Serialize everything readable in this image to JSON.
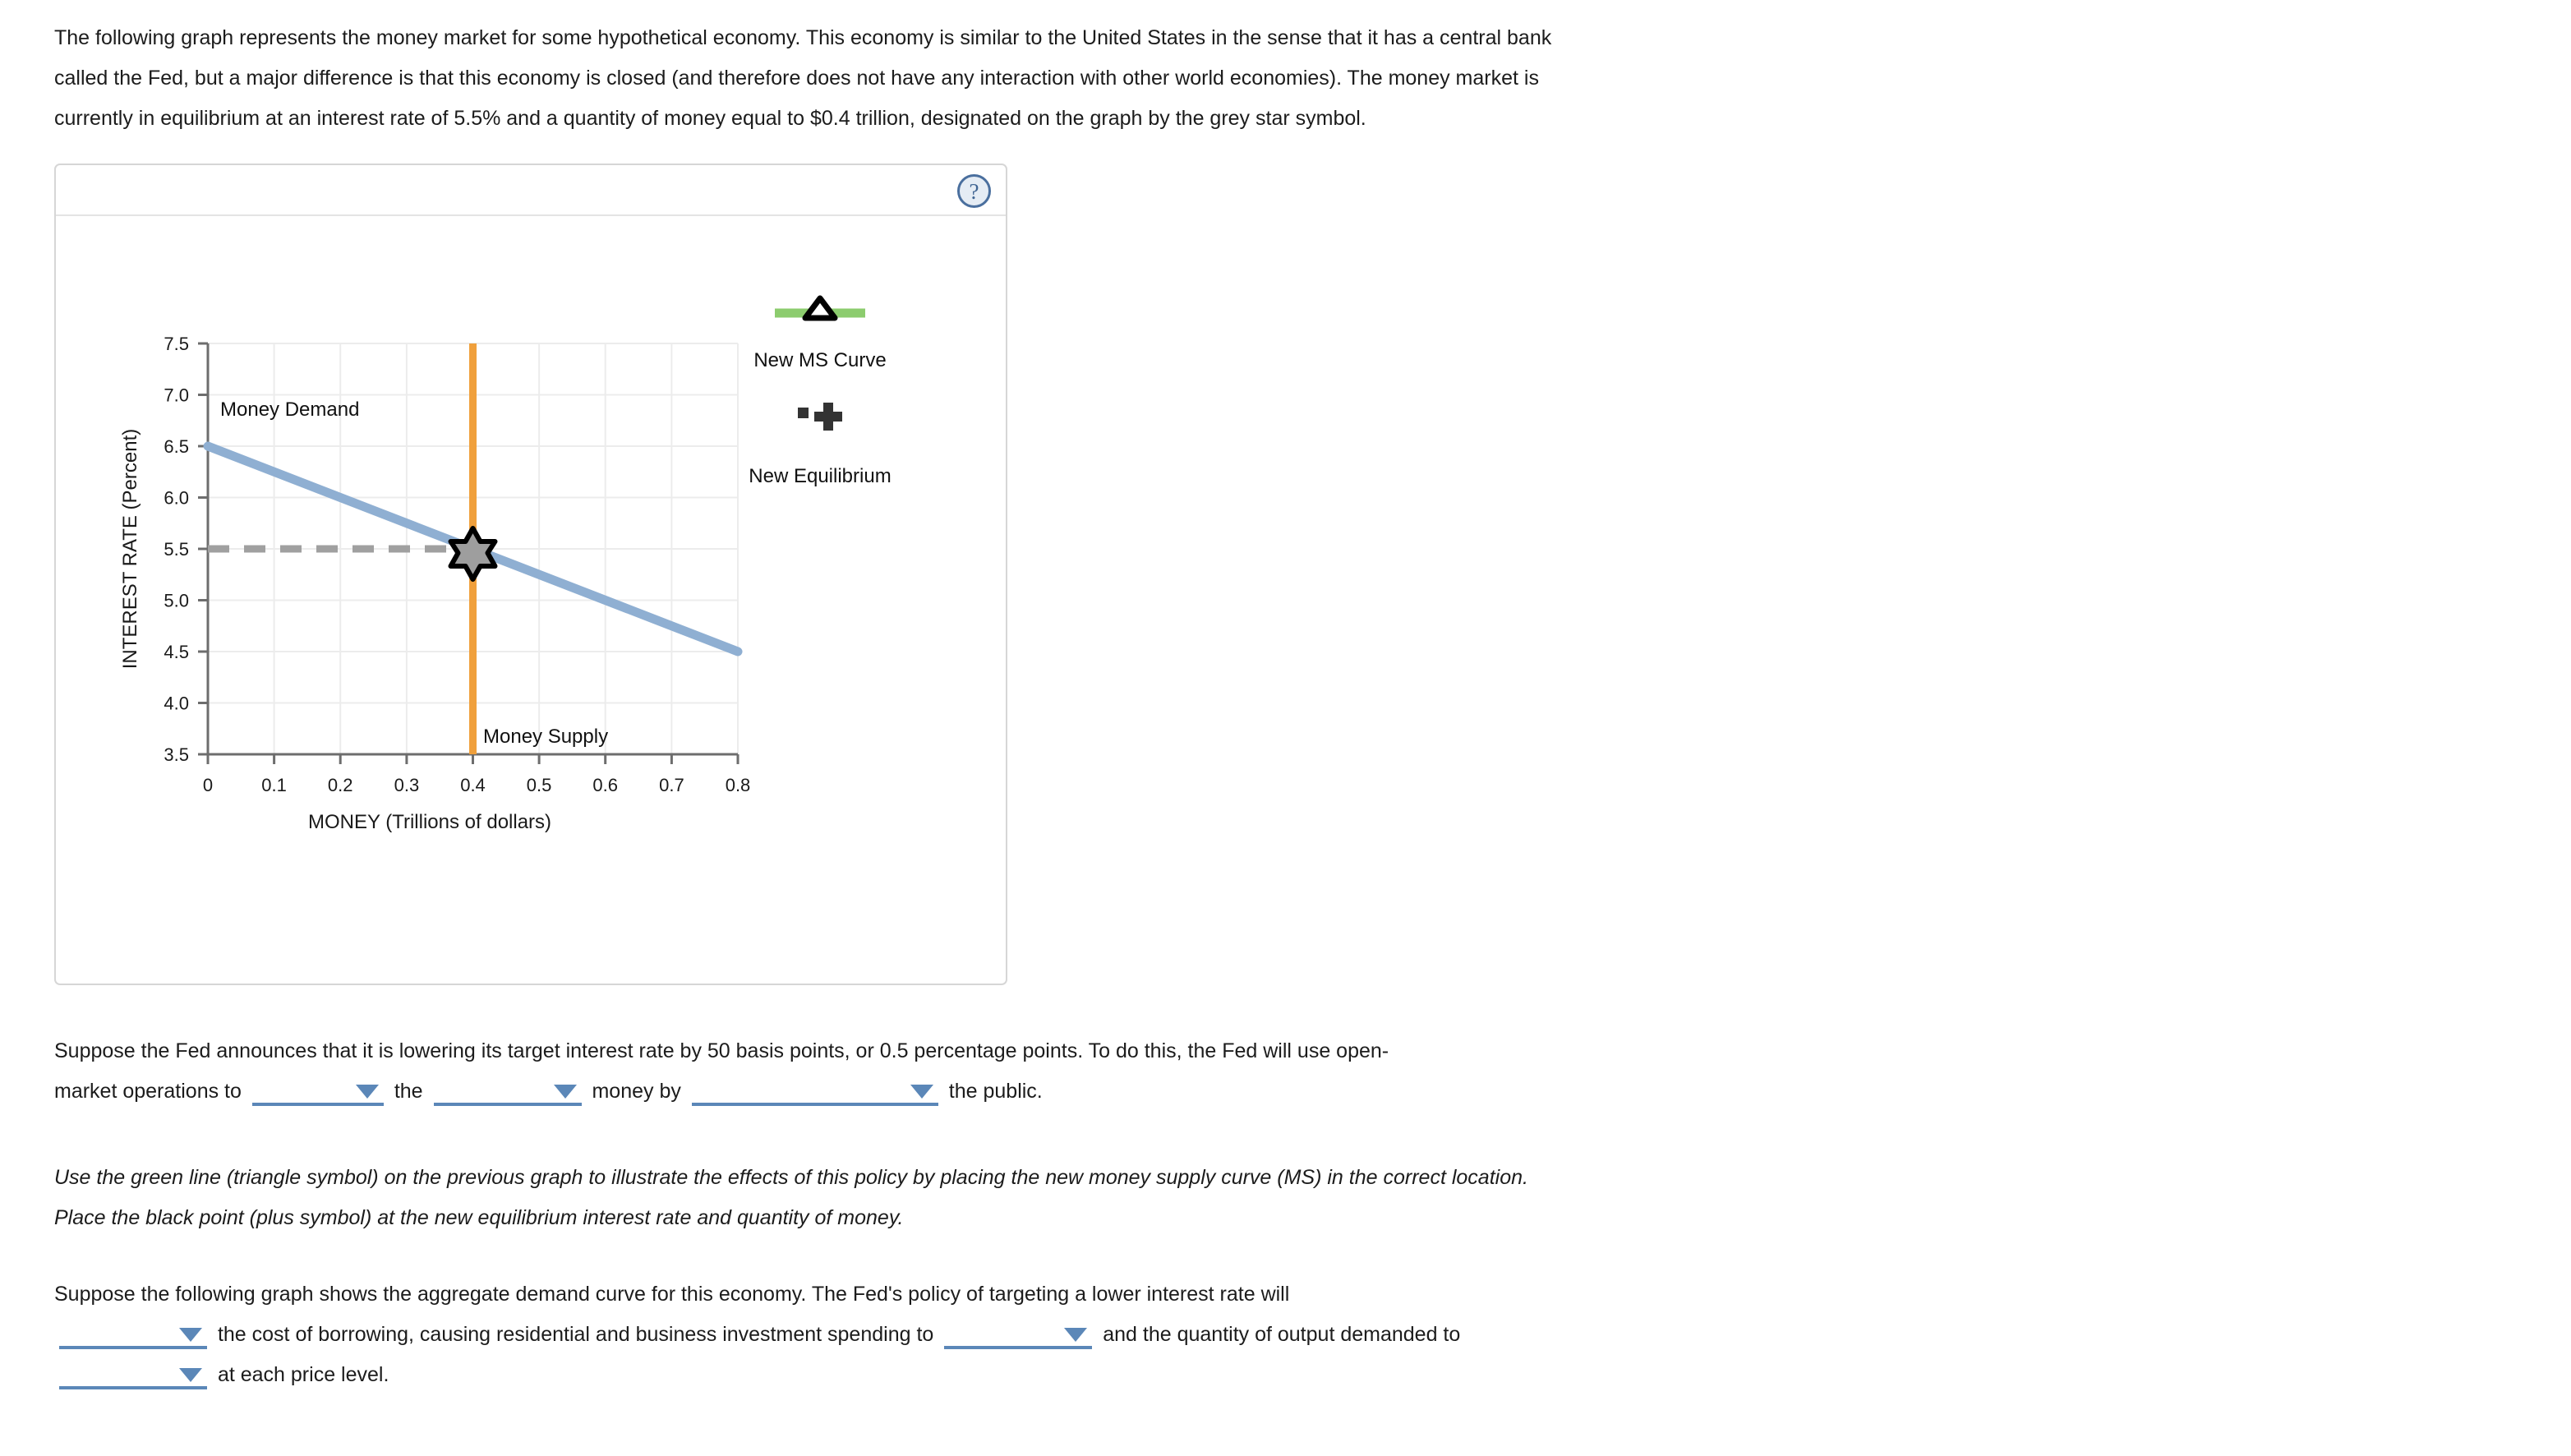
{
  "intro": {
    "paragraph": "The following graph represents the money market for some hypothetical economy. This economy is similar to the United States in the sense that it has a central bank called the Fed, but a major difference is that this economy is closed (and therefore does not have any interaction with other world economies). The money market is currently in equilibrium at an interest rate of 5.5% and a quantity of money equal to $0.4 trillion, designated on the graph by the grey star symbol."
  },
  "graph_panel": {
    "help_icon_label": "?"
  },
  "chart_data": {
    "type": "line",
    "title": "",
    "xlabel": "MONEY (Trillions of dollars)",
    "ylabel": "INTEREST RATE (Percent)",
    "xlim": [
      0,
      0.8
    ],
    "ylim": [
      3.5,
      7.5
    ],
    "xticks": [
      "0",
      "0.1",
      "0.2",
      "0.3",
      "0.4",
      "0.5",
      "0.6",
      "0.7",
      "0.8"
    ],
    "yticks": [
      "3.5",
      "4.0",
      "4.5",
      "5.0",
      "5.5",
      "6.0",
      "6.5",
      "7.0",
      "7.5"
    ],
    "grid": true,
    "series": [
      {
        "name": "Money Demand",
        "label": "Money Demand",
        "color": "#8fafd2",
        "points": [
          [
            0,
            6.5
          ],
          [
            0.8,
            4.5
          ]
        ]
      },
      {
        "name": "Money Supply",
        "label": "Money Supply",
        "color": "#f0a03c",
        "points": [
          [
            0.4,
            3.5
          ],
          [
            0.4,
            7.5
          ]
        ]
      }
    ],
    "annotations": [
      {
        "name": "equilibrium-star",
        "symbol": "star",
        "x": 0.4,
        "y": 5.5,
        "fill": "#9e9e9e",
        "stroke": "#000000"
      },
      {
        "name": "equilibrium-guide",
        "symbol": "dashed-line",
        "from": [
          0,
          5.5
        ],
        "to": [
          0.4,
          5.5
        ],
        "color": "#a0a0a0"
      }
    ],
    "legend": {
      "position": "right",
      "entries": [
        {
          "label": "New MS Curve",
          "symbol": "triangle",
          "line_color": "#8ccc6e",
          "marker_color": "#ffffff",
          "marker_stroke": "#000000"
        },
        {
          "label": "New Equilibrium",
          "symbol": "plus",
          "color": "#333333"
        }
      ]
    }
  },
  "question1": {
    "line1": "Suppose the Fed announces that it is lowering its target interest rate by 50 basis points, or 0.5 percentage points. To do this, the Fed will use open-",
    "seg1": "market operations to",
    "seg2": "the",
    "seg3": "money by",
    "seg4": "the public.",
    "dropdown1_value": "",
    "dropdown2_value": "",
    "dropdown3_value": ""
  },
  "instruction": {
    "text": "Use the green line (triangle symbol) on the previous graph to illustrate the effects of this policy by placing the new money supply curve (MS) in the correct location. Place the black point (plus symbol) at the new equilibrium interest rate and quantity of money."
  },
  "question2": {
    "line1": "Suppose the following graph shows the aggregate demand curve for this economy. The Fed's policy of targeting a lower interest rate will",
    "seg1": "the cost of borrowing, causing residential and business investment spending to",
    "seg2": "and the quantity of output demanded to",
    "seg3": "at each price level.",
    "dropdown1_value": "",
    "dropdown2_value": "",
    "dropdown3_value": ""
  }
}
